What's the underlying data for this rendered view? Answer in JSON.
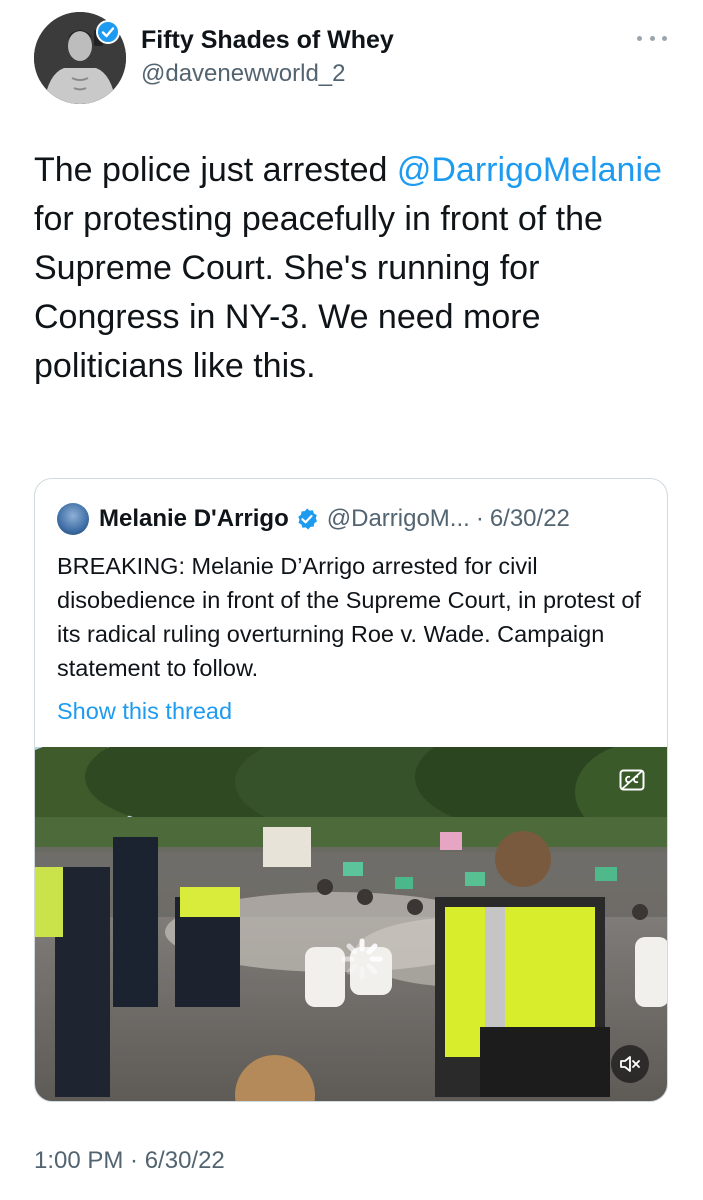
{
  "author": {
    "display_name": "Fifty Shades of Whey",
    "handle": "@davenewworld_2",
    "avatar_icon": "shirtless-man-avatar",
    "verified": true
  },
  "tweet": {
    "text_before": "The police just arrested ",
    "mention": "@DarrigoMelanie",
    "text_after": " for protesting peacefully in front of the Supreme Court. She's running for Congress in NY-3. We need more politicians like this.",
    "timestamp": "1:00 PM · 6/30/22"
  },
  "quoted": {
    "display_name": "Melanie D'Arrigo",
    "verified": true,
    "handle": "@DarrigoM...",
    "separator": "·",
    "date": "6/30/22",
    "text": "BREAKING: Melanie D’Arrigo arrested for civil disobedience in front of the Supreme Court, in protest of its radical ruling overturning Roe v. Wade. Campaign statement to follow.",
    "show_thread": "Show this thread",
    "media": {
      "type": "video",
      "icons": [
        "loading-spinner-icon",
        "closed-captions-icon",
        "mute-icon"
      ]
    }
  },
  "colors": {
    "link": "#1d9bf0",
    "secondary_text": "#536471",
    "border": "#cfd9de",
    "verified_badge": "#1d9bf0"
  }
}
